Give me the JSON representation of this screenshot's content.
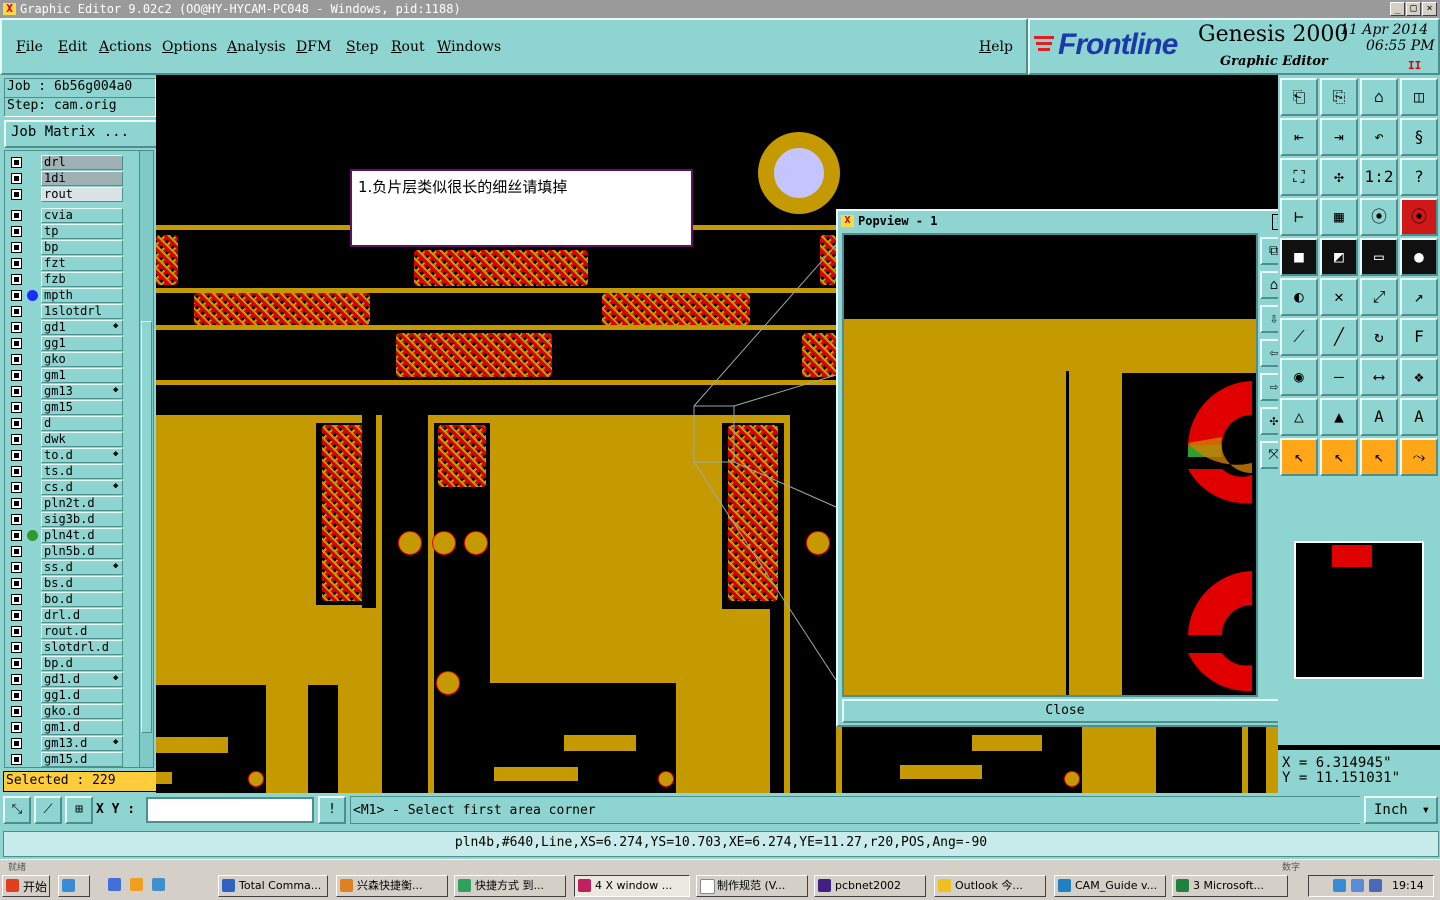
{
  "window": {
    "title": "Graphic Editor 9.02c2 (OO@HY-HYCAM-PC048 - Windows, pid:1188)"
  },
  "menu": [
    "File",
    "Edit",
    "Actions",
    "Options",
    "Analysis",
    "DFM",
    "Step",
    "Rout",
    "Windows"
  ],
  "help_label": "Help",
  "brand": {
    "logo": "Frontline",
    "product": "Genesis 2000",
    "subtitle": "Graphic Editor",
    "date": "11 Apr 2014",
    "time": "06:55 PM",
    "pause_glyph": "II"
  },
  "job": {
    "job_label": "Job : 6b56g004a0",
    "step_label": "Step: cam.orig",
    "matrix_button": "Job Matrix ..."
  },
  "layers": [
    {
      "name": "drl",
      "style": "grey"
    },
    {
      "name": "1di",
      "style": "grey"
    },
    {
      "name": "rout",
      "style": "light"
    },
    {
      "name": "cvia",
      "style": ""
    },
    {
      "name": "tp",
      "style": ""
    },
    {
      "name": "bp",
      "style": ""
    },
    {
      "name": "fzt",
      "style": ""
    },
    {
      "name": "fzb",
      "style": ""
    },
    {
      "name": "mpth",
      "style": "",
      "dot": "#1a2cff"
    },
    {
      "name": "1slotdrl",
      "style": ""
    },
    {
      "name": "gd1",
      "style": "",
      "mark": true
    },
    {
      "name": "gg1",
      "style": ""
    },
    {
      "name": "gko",
      "style": ""
    },
    {
      "name": "gm1",
      "style": ""
    },
    {
      "name": "gm13",
      "style": "",
      "mark": true
    },
    {
      "name": "gm15",
      "style": ""
    },
    {
      "name": "d",
      "style": ""
    },
    {
      "name": "dwk",
      "style": ""
    },
    {
      "name": "to.d",
      "style": "",
      "mark": true
    },
    {
      "name": "ts.d",
      "style": ""
    },
    {
      "name": "cs.d",
      "style": "",
      "mark": true
    },
    {
      "name": "pln2t.d",
      "style": ""
    },
    {
      "name": "sig3b.d",
      "style": ""
    },
    {
      "name": "pln4t.d",
      "style": "",
      "dot": "#2e9a2e"
    },
    {
      "name": "pln5b.d",
      "style": ""
    },
    {
      "name": "ss.d",
      "style": "",
      "mark": true
    },
    {
      "name": "bs.d",
      "style": ""
    },
    {
      "name": "bo.d",
      "style": ""
    },
    {
      "name": "drl.d",
      "style": ""
    },
    {
      "name": "rout.d",
      "style": ""
    },
    {
      "name": "slotdrl.d",
      "style": ""
    },
    {
      "name": "bp.d",
      "style": ""
    },
    {
      "name": "gd1.d",
      "style": "",
      "mark": true
    },
    {
      "name": "gg1.d",
      "style": ""
    },
    {
      "name": "gko.d",
      "style": ""
    },
    {
      "name": "gm1.d",
      "style": ""
    },
    {
      "name": "gm13.d",
      "style": "",
      "mark": true
    },
    {
      "name": "gm15.d",
      "style": ""
    }
  ],
  "selected_label": "Selected : 229",
  "note_text": "1.负片层类似很长的细丝请填掉",
  "popview": {
    "title": "Popview - 1",
    "close_button": "Close"
  },
  "coords": {
    "x": "X =  6.314945\"",
    "y": "Y = 11.151031\""
  },
  "command": {
    "xy_label": "X Y :",
    "xy_value": "",
    "prompt": "<M1> - Select first area corner",
    "unit": "Inch"
  },
  "status_text": "pln4b,#640,Line,XS=6.274,YS=10.703,XE=6.274,YE=11.27,r20,POS,Ang=-90",
  "taskbar": {
    "start": "开始",
    "tasks": [
      "Total Comma...",
      "兴森快捷衡...",
      "快捷方式 到...",
      "4 X window ...",
      "制作规范 (V...",
      "pcbnet2002",
      "Outlook 今...",
      "CAM_Guide v...",
      "3 Microsoft..."
    ],
    "clock": "19:14",
    "hint_left": "就绪",
    "hint_right": "数字"
  },
  "colors": {
    "panel": "#8ed5d2",
    "copper": "#c49a00",
    "highlight": "#d80000",
    "selected_bg": "#ffcc3b"
  }
}
